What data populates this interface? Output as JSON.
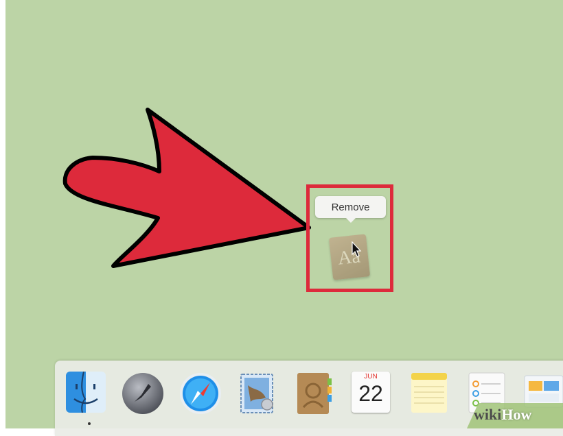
{
  "tooltip": {
    "label": "Remove"
  },
  "dragged_icon": {
    "name": "dictionary-icon",
    "glyph": "Aa"
  },
  "dock": {
    "items": [
      {
        "name": "finder-icon"
      },
      {
        "name": "launchpad-icon"
      },
      {
        "name": "safari-icon"
      },
      {
        "name": "mail-icon"
      },
      {
        "name": "contacts-icon"
      },
      {
        "name": "calendar-icon"
      },
      {
        "name": "notes-icon"
      },
      {
        "name": "reminders-icon"
      },
      {
        "name": "app-icon"
      }
    ],
    "calendar": {
      "month": "JUN",
      "day": "22"
    }
  },
  "watermark": {
    "wiki": "wiki",
    "how": "How"
  },
  "colors": {
    "desktop": "#bcd4a6",
    "arrow": "#dd2a3b",
    "highlight": "#dd2a3b"
  }
}
